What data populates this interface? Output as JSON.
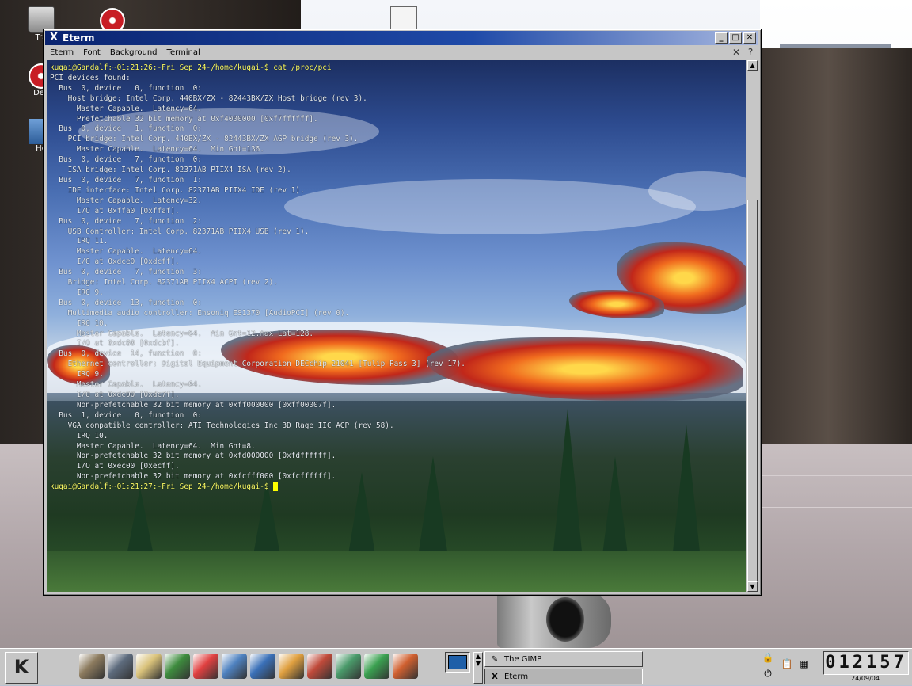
{
  "desktop": {
    "icons": [
      {
        "name": "trash-icon",
        "label": "Tra"
      },
      {
        "name": "cdrom-icon",
        "label": "Dev"
      },
      {
        "name": "home-icon",
        "label": "Ho"
      }
    ]
  },
  "window": {
    "title": "Eterm",
    "buttons": {
      "minimize": "_",
      "maximize": "□",
      "close": "✕"
    },
    "menu": [
      "Eterm",
      "Font",
      "Background",
      "Terminal"
    ],
    "menu_right": {
      "close": "✕",
      "help": "?"
    }
  },
  "terminal": {
    "lines": [
      {
        "prompt": true,
        "text": "kugai@Gandalf:~01:21:26:-Fri Sep 24-/home/kugai-$ cat /proc/pci"
      },
      {
        "text": "PCI devices found:"
      },
      {
        "text": "  Bus  0, device   0, function  0:"
      },
      {
        "text": "    Host bridge: Intel Corp. 440BX/ZX - 82443BX/ZX Host bridge (rev 3)."
      },
      {
        "text": "      Master Capable.  Latency=64."
      },
      {
        "text": "      Prefetchable 32 bit memory at 0xf4000000 [0xf7ffffff]."
      },
      {
        "text": "  Bus  0, device   1, function  0:"
      },
      {
        "text": "    PCI bridge: Intel Corp. 440BX/ZX - 82443BX/ZX AGP bridge (rev 3)."
      },
      {
        "text": "      Master Capable.  Latency=64.  Min Gnt=136."
      },
      {
        "text": "  Bus  0, device   7, function  0:"
      },
      {
        "text": "    ISA bridge: Intel Corp. 82371AB PIIX4 ISA (rev 2)."
      },
      {
        "text": "  Bus  0, device   7, function  1:"
      },
      {
        "text": "    IDE interface: Intel Corp. 82371AB PIIX4 IDE (rev 1)."
      },
      {
        "text": "      Master Capable.  Latency=32."
      },
      {
        "text": "      I/O at 0xffa0 [0xffaf]."
      },
      {
        "text": "  Bus  0, device   7, function  2:"
      },
      {
        "text": "    USB Controller: Intel Corp. 82371AB PIIX4 USB (rev 1)."
      },
      {
        "text": "      IRQ 11."
      },
      {
        "text": "      Master Capable.  Latency=64."
      },
      {
        "text": "      I/O at 0xdce0 [0xdcff]."
      },
      {
        "text": "  Bus  0, device   7, function  3:"
      },
      {
        "text": "    Bridge: Intel Corp. 82371AB PIIX4 ACPI (rev 2)."
      },
      {
        "text": "      IRQ 9."
      },
      {
        "text": "  Bus  0, device  13, function  0:"
      },
      {
        "text": "    Multimedia audio controller: Ensoniq ES1370 [AudioPCI] (rev 0)."
      },
      {
        "text": "      IRQ 10."
      },
      {
        "text": "      Master Capable.  Latency=64.  Min Gnt=12.Max Lat=128."
      },
      {
        "text": "      I/O at 0xdc80 [0xdcbf]."
      },
      {
        "text": "  Bus  0, device  14, function  0:"
      },
      {
        "text": "    Ethernet controller: Digital Equipment Corporation DECchip 21041 [Tulip Pass 3] (rev 17)."
      },
      {
        "text": "      IRQ 9."
      },
      {
        "text": "      Master Capable.  Latency=64."
      },
      {
        "text": "      I/O at 0xdc00 [0xdc7f]."
      },
      {
        "text": "      Non-prefetchable 32 bit memory at 0xff000000 [0xff00007f]."
      },
      {
        "text": "  Bus  1, device   0, function  0:"
      },
      {
        "text": "    VGA compatible controller: ATI Technologies Inc 3D Rage IIC AGP (rev 58)."
      },
      {
        "text": "      IRQ 10."
      },
      {
        "text": "      Master Capable.  Latency=64.  Min Gnt=8."
      },
      {
        "text": "      Non-prefetchable 32 bit memory at 0xfd000000 [0xfdffffff]."
      },
      {
        "text": "      I/O at 0xec00 [0xecff]."
      },
      {
        "text": "      Non-prefetchable 32 bit memory at 0xfcfff000 [0xfcffffff]."
      }
    ],
    "final_prompt": "kugai@Gandalf:~01:21:27:-Fri Sep 24-/home/kugai-$ "
  },
  "scrollbar": {
    "up": "▲",
    "down": "▼"
  },
  "taskbar": {
    "kmenu_label": "K",
    "launchers": [
      {
        "name": "printer-icon",
        "color": "#8c7b5e"
      },
      {
        "name": "window-list-icon",
        "color": "#5d6b7d"
      },
      {
        "name": "shell-icon",
        "color": "#d9c27a"
      },
      {
        "name": "terminal-icon",
        "color": "#3e8c3e"
      },
      {
        "name": "help-lifebuoy-icon",
        "color": "#e04040"
      },
      {
        "name": "file-manager-icon",
        "color": "#4f82c0"
      },
      {
        "name": "browser-globe-icon",
        "color": "#3a70b8"
      },
      {
        "name": "vector-draw-icon",
        "color": "#e0a040"
      },
      {
        "name": "write-pen-icon",
        "color": "#c04a3a"
      },
      {
        "name": "spreadsheet-icon",
        "color": "#4a9a6a"
      },
      {
        "name": "chart-icon",
        "color": "#3aa050"
      },
      {
        "name": "presentation-icon",
        "color": "#d06030"
      }
    ],
    "arrow_up": "▲",
    "arrow_down": "▼",
    "tasks": [
      {
        "icon": "✎",
        "label": "The GIMP",
        "active": false
      },
      {
        "icon": "X",
        "label": "Eterm",
        "active": true
      }
    ],
    "tray": {
      "lock": "🔒",
      "power": "⏻",
      "clipboard": "📋",
      "calendar": "▦"
    },
    "clock": "01:21:57",
    "clock_display": "012157",
    "date": "24/09/04"
  }
}
